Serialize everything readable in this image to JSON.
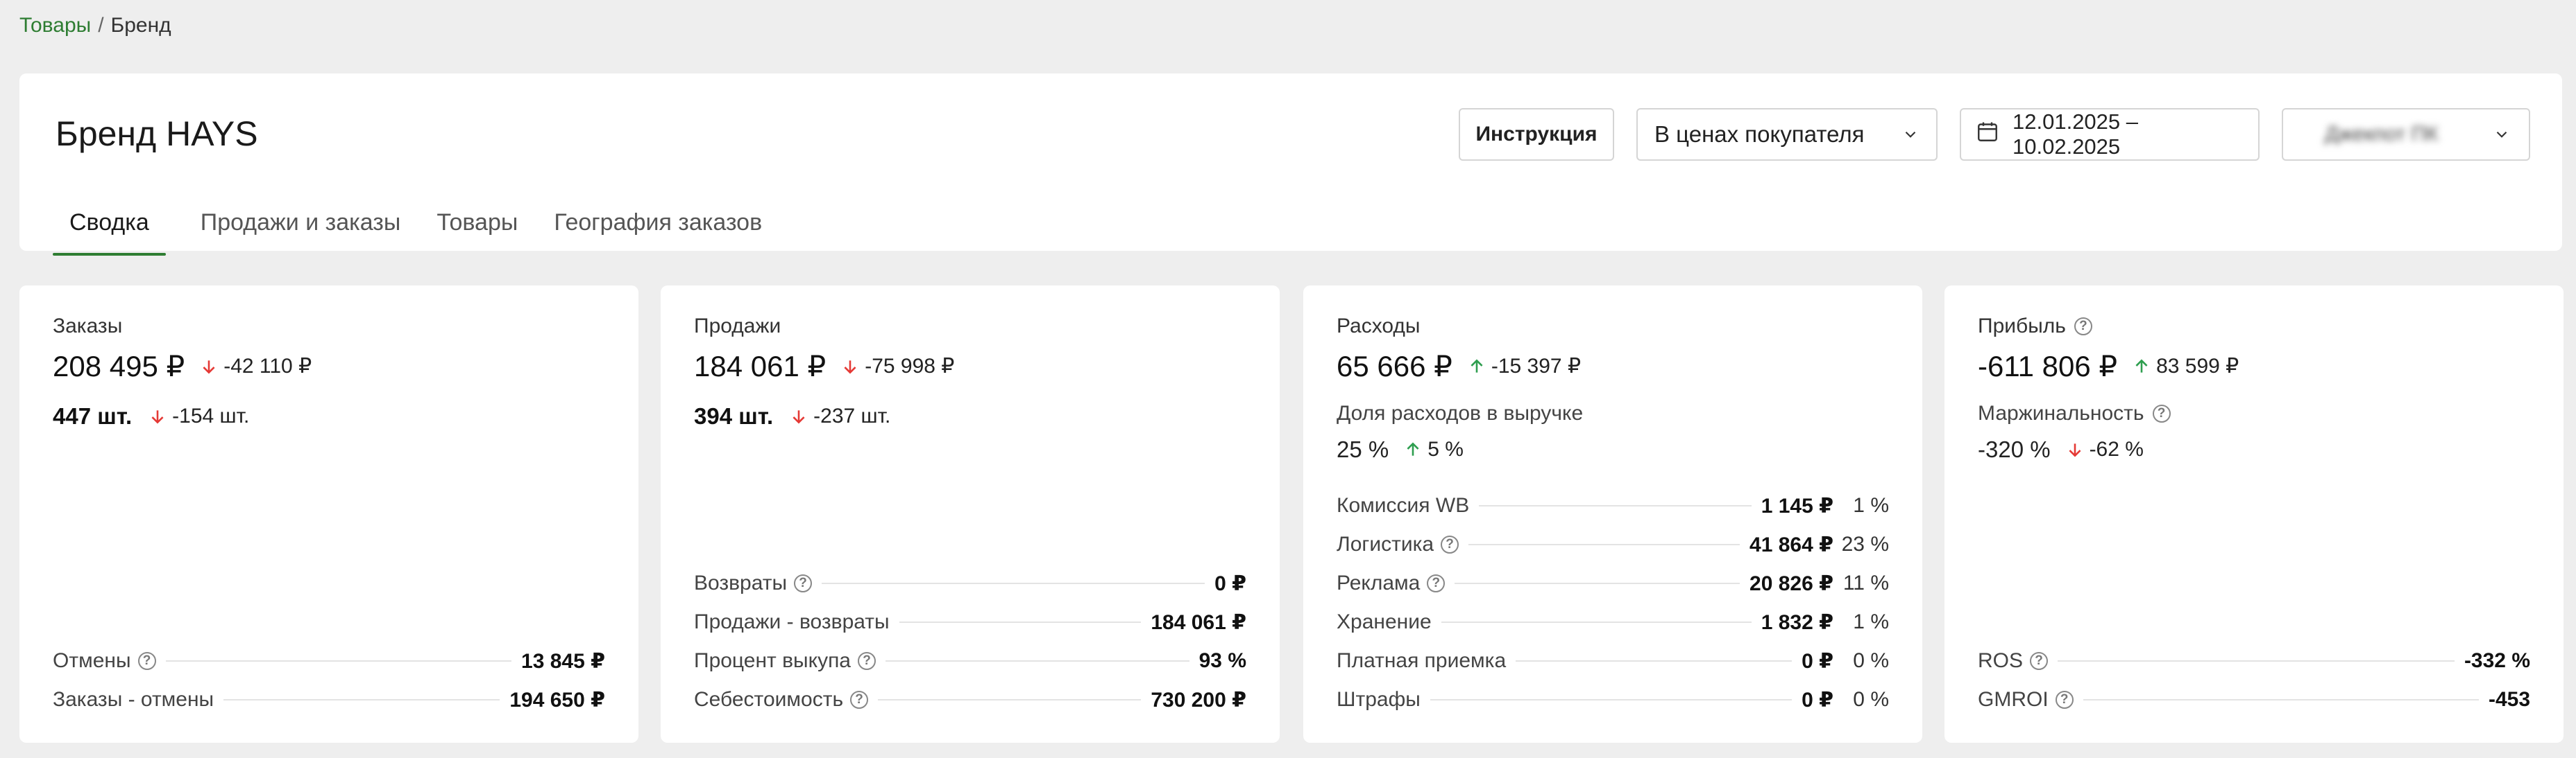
{
  "breadcrumb": {
    "parent": "Товары",
    "separator": "/",
    "current": "Бренд"
  },
  "header": {
    "title": "Бренд HAYS",
    "instruction_label": "Инструкция",
    "price_mode": "В ценах покупателя",
    "date_range": "12.01.2025 – 10.02.2025",
    "account": "Джекпот ПК",
    "tabs": [
      "Сводка",
      "Продажи и заказы",
      "Товары",
      "География заказов"
    ],
    "active_tab": 0
  },
  "colors": {
    "accent": "#2e7d32",
    "up": "#2e9e4f",
    "down": "#e53935"
  },
  "cards": {
    "orders": {
      "title": "Заказы",
      "amount": "208 495 ₽",
      "amount_delta": "-42 110 ₽",
      "amount_dir": "down",
      "qty": "447 шт.",
      "qty_delta": "-154 шт.",
      "qty_dir": "down",
      "rows": [
        {
          "label": "Отмены",
          "value": "13 845 ₽"
        },
        {
          "label": "Заказы - отмены",
          "value": "194 650 ₽"
        }
      ]
    },
    "sales": {
      "title": "Продажи",
      "amount": "184 061 ₽",
      "amount_delta": "-75 998 ₽",
      "amount_dir": "down",
      "qty": "394 шт.",
      "qty_delta": "-237 шт.",
      "qty_dir": "down",
      "rows": [
        {
          "label": "Возвраты",
          "value": "0 ₽"
        },
        {
          "label": "Продажи - возвраты",
          "value": "184 061 ₽"
        },
        {
          "label": "Процент выкупа",
          "value": "93 %"
        },
        {
          "label": "Себестоимость",
          "value": "730 200 ₽"
        }
      ]
    },
    "expenses": {
      "title": "Расходы",
      "amount": "65 666 ₽",
      "amount_delta": "-15 397 ₽",
      "amount_dir": "up",
      "share_label": "Доля расходов в выручке",
      "share": "25 %",
      "share_delta": "5 %",
      "share_dir": "up",
      "rows": [
        {
          "label": "Комиссия WB",
          "value": "1 145 ₽",
          "pct": "1 %"
        },
        {
          "label": "Логистика",
          "value": "41 864 ₽",
          "pct": "23 %"
        },
        {
          "label": "Реклама",
          "value": "20 826 ₽",
          "pct": "11 %"
        },
        {
          "label": "Хранение",
          "value": "1 832 ₽",
          "pct": "1 %"
        },
        {
          "label": "Платная приемка",
          "value": "0 ₽",
          "pct": "0 %"
        },
        {
          "label": "Штрафы",
          "value": "0 ₽",
          "pct": "0 %"
        }
      ]
    },
    "profit": {
      "title": "Прибыль",
      "amount": "-611 806 ₽",
      "amount_delta": "83 599 ₽",
      "amount_dir": "up",
      "margin_label": "Маржинальность",
      "margin": "-320 %",
      "margin_delta": "-62 %",
      "margin_dir": "down",
      "rows": [
        {
          "label": "ROS",
          "value": "-332 %"
        },
        {
          "label": "GMROI",
          "value": "-453"
        }
      ]
    }
  }
}
